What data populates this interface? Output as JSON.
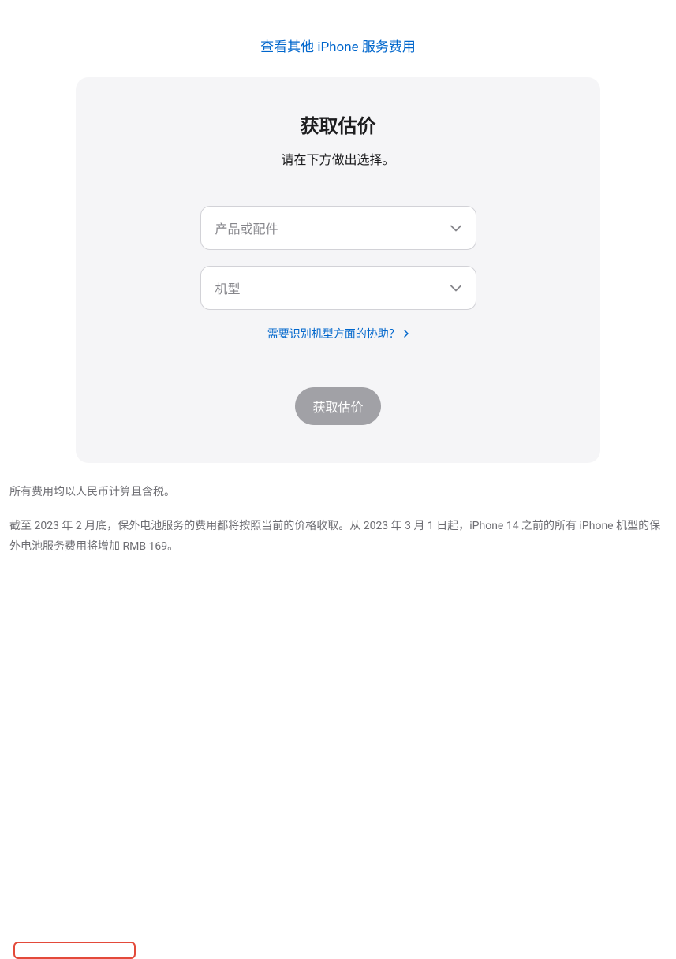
{
  "topLink": "查看其他 iPhone 服务费用",
  "card": {
    "title": "获取估价",
    "subtitle": "请在下方做出选择。",
    "select1Placeholder": "产品或配件",
    "select2Placeholder": "机型",
    "helpLink": "需要识别机型方面的协助？",
    "submitLabel": "获取估价"
  },
  "notes": {
    "line1": "所有费用均以人民币计算且含税。",
    "line2": "截至 2023 年 2 月底，保外电池服务的费用都将按照当前的价格收取。从 2023 年 3 月 1 日起，iPhone 14 之前的所有 iPhone 机型的保外电池服务费用将增加 RMB 169。"
  }
}
